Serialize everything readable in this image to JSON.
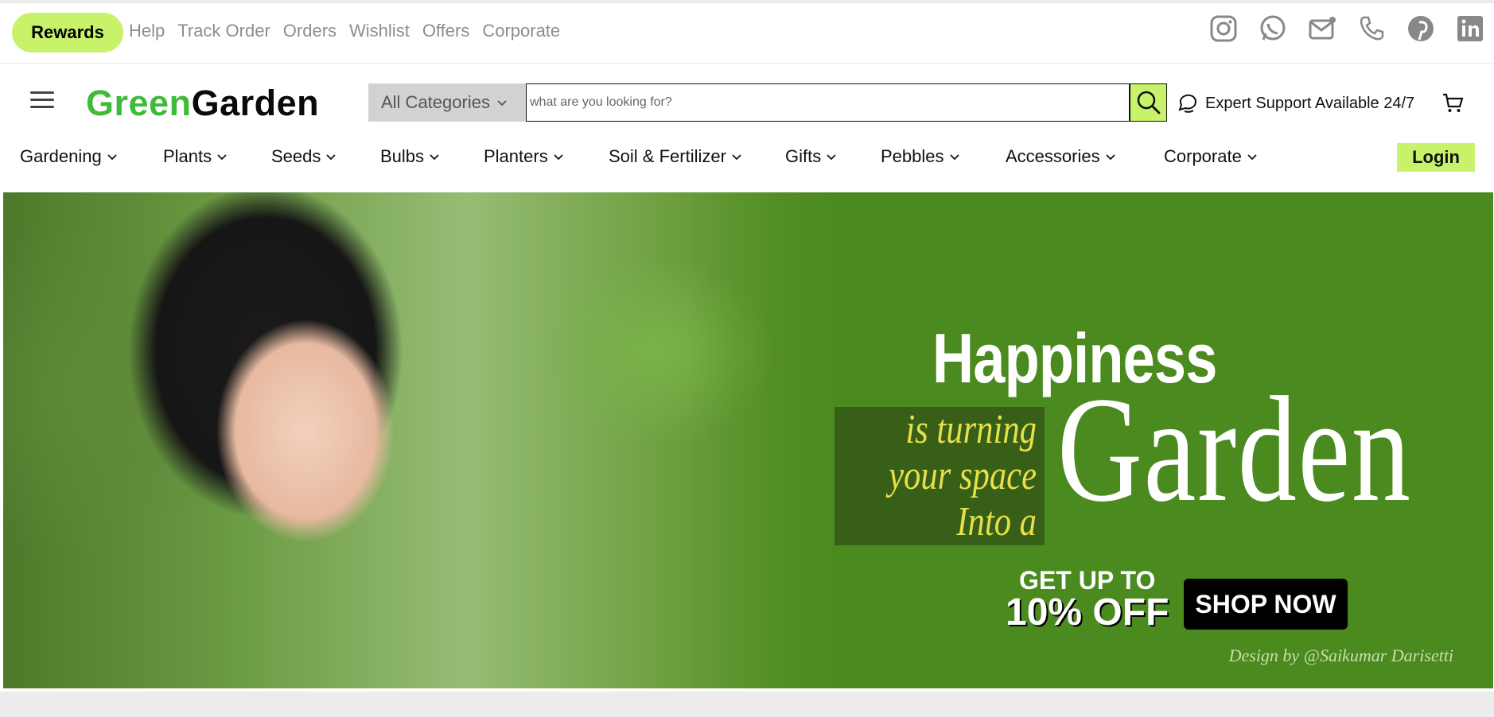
{
  "topbar": {
    "rewards_label": "Rewards",
    "links": [
      "Help",
      "Track Order",
      "Orders",
      "Wishlist",
      "Offers",
      "Corporate"
    ],
    "social_icons": [
      "instagram-icon",
      "whatsapp-icon",
      "mail-icon",
      "phone-icon",
      "pinterest-icon",
      "linkedin-icon"
    ]
  },
  "header": {
    "logo_part1": "Green",
    "logo_part2": "Garden",
    "category_label": "All Categories",
    "search_placeholder": "what are you looking for?",
    "support_text": "Expert Support Available 24/7"
  },
  "nav": {
    "items": [
      "Gardening",
      "Plants",
      "Seeds",
      "Bulbs",
      "Planters",
      "Soil & Fertilizer",
      "Gifts",
      "Pebbles",
      "Accessories",
      "Corporate"
    ],
    "login_label": "Login"
  },
  "hero": {
    "headline": "Happiness",
    "line1": "is turning",
    "line2": "your space",
    "line3": "Into a",
    "big_word": "Garden",
    "offer_line1": "GET UP TO",
    "offer_line2": "10% OFF",
    "cta_label": "SHOP NOW",
    "credit": "Design by @Saikumar Darisetti"
  },
  "colors": {
    "accent": "#c8f26a",
    "brand_green": "#3fba3b",
    "hero_green": "#4a8a1e"
  }
}
